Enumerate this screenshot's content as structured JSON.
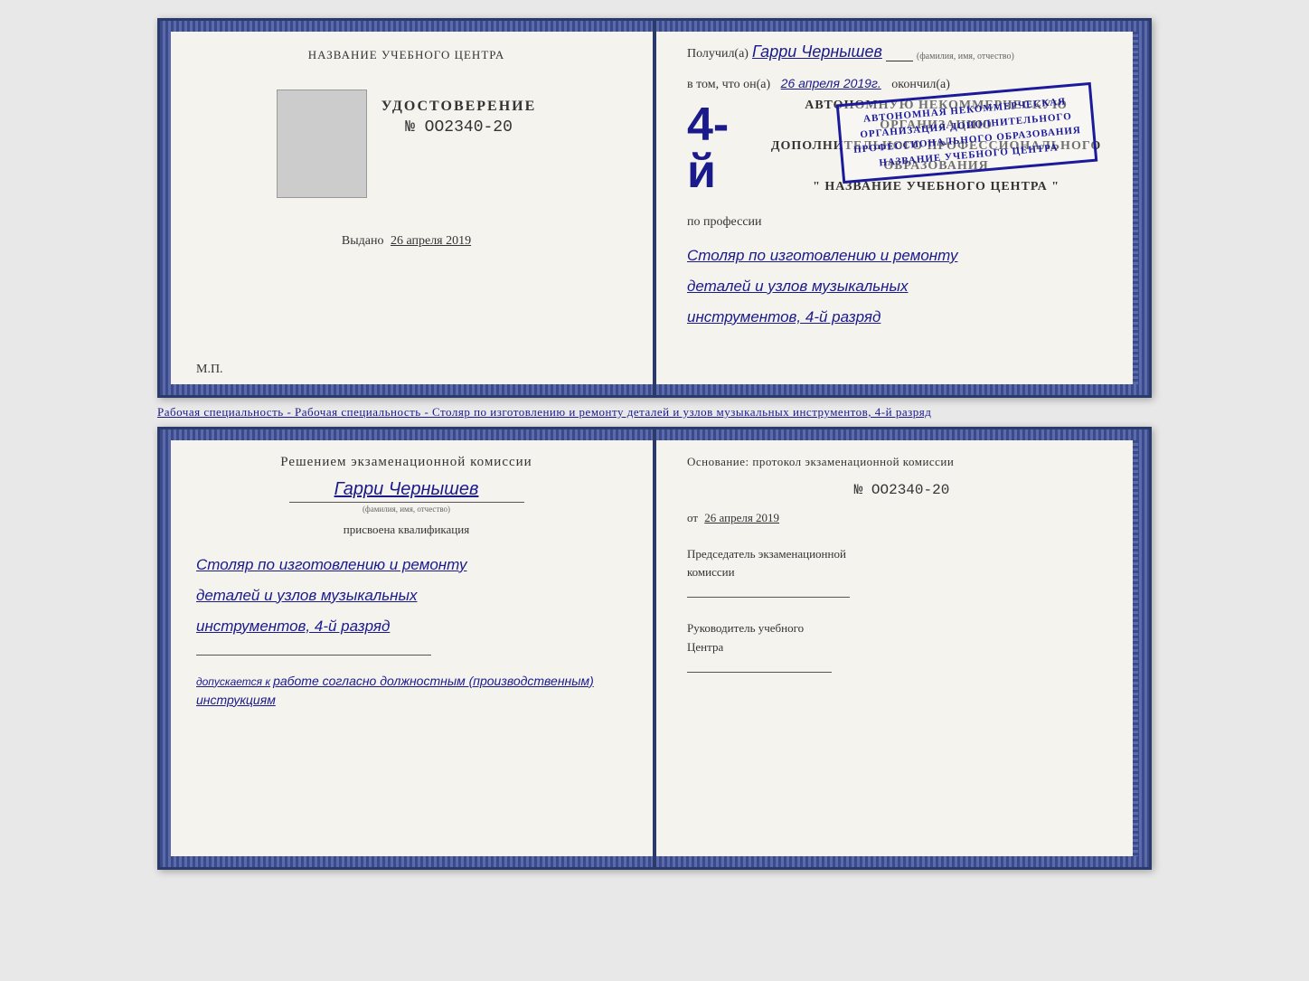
{
  "page": {
    "background": "#e8e8e8"
  },
  "diploma": {
    "left": {
      "center_title": "НАЗВАНИЕ УЧЕБНОГО ЦЕНТРА",
      "udostoverenie": "УДОСТОВЕРЕНИЕ",
      "number": "№ OO2340-20",
      "vydano_label": "Выдано",
      "vydano_date": "26 апреля 2019",
      "mp": "М.П."
    },
    "right": {
      "poluchil_prefix": "Получил(а)",
      "name_handwritten": "Гарри Чернышев",
      "name_sublabel": "(фамилия, имя, отчество)",
      "vtom_prefix": "в том, что он(а)",
      "vtom_date": "26 апреля 2019г.",
      "okonchil": "окончил(а)",
      "year_big": "4-й",
      "org_line1": "АВТОНОМНУЮ НЕКОММЕРЧЕСКУЮ ОРГАНИЗАЦИЮ",
      "org_line2": "ДОПОЛНИТЕЛЬНОГО ПРОФЕССИОНАЛЬНОГО ОБРАЗОВАНИЯ",
      "org_line3": "\"  НАЗВАНИЕ УЧЕБНОГО ЦЕНТРА  \"",
      "po_professii": "по профессии",
      "profession_line1": "Столяр по изготовлению и ремонту",
      "profession_line2": "деталей и узлов музыкальных",
      "profession_line3": "инструментов, 4-й разряд"
    }
  },
  "subtitle": {
    "text": "Рабочая специальность - Столяр по изготовлению и ремонту деталей и узлов музыкальных инструментов, 4-й разряд"
  },
  "qualification": {
    "left": {
      "title": "Решением  экзаменационной  комиссии",
      "name_handwritten": "Гарри Чернышев",
      "name_sublabel": "(фамилия, имя, отчество)",
      "prisvoena": "присвоена квалификация",
      "profession_line1": "Столяр по изготовлению и ремонту",
      "profession_line2": "деталей и узлов музыкальных",
      "profession_line3": "инструментов, 4-й разряд",
      "dopuskaetsya_prefix": "допускается к",
      "dopuskaetsya_text": "работе согласно должностным (производственным) инструкциям"
    },
    "right": {
      "osnovaniye": "Основание: протокол экзаменационной  комиссии",
      "number": "№  OO2340-20",
      "ot_prefix": "от",
      "ot_date": "26 апреля 2019",
      "predsedatel_line1": "Председатель экзаменационной",
      "predsedatel_line2": "комиссии",
      "rukovoditel_line1": "Руководитель учебного",
      "rukovoditel_line2": "Центра"
    }
  }
}
